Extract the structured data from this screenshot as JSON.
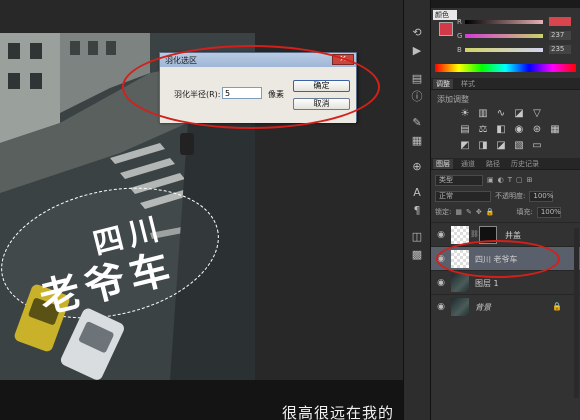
{
  "dialog": {
    "title": "羽化选区",
    "close_glyph": "×",
    "radius_label": "羽化半径(R):",
    "radius_value": "5",
    "unit": "像素",
    "ok_label": "确定",
    "cancel_label": "取消"
  },
  "canvas": {
    "text_line1": "四川",
    "text_line2": "老爷车",
    "subtitle": "很高很远在我的"
  },
  "color_panel": {
    "title_label": "颜色",
    "sliders": [
      {
        "letter": "R",
        "value": ""
      },
      {
        "letter": "G",
        "value": "237"
      },
      {
        "letter": "B",
        "value": "235"
      }
    ]
  },
  "adjust_panel": {
    "tabs": [
      "调整",
      "样式"
    ],
    "title": "添加调整"
  },
  "layers_panel": {
    "tabs": [
      "图层",
      "通道",
      "路径",
      "历史记录"
    ],
    "filter_label": "类型",
    "blend_mode": "正常",
    "opacity_label": "不透明度:",
    "opacity_value": "100%",
    "lock_label": "锁定:",
    "fill_label": "填充:",
    "fill_value": "100%",
    "layers": [
      {
        "name": "井盖"
      },
      {
        "name": "四川 老爷车"
      },
      {
        "name": "图层 1"
      },
      {
        "name": "背景"
      }
    ]
  },
  "colors": {
    "annotation_red": "#d3201a",
    "selected_layer": "#5a5f6c",
    "foreground_swatch": "#d23a4a"
  },
  "icons": {
    "eye": "eye-icon",
    "lock": "lock-icon",
    "close": "close-icon"
  }
}
